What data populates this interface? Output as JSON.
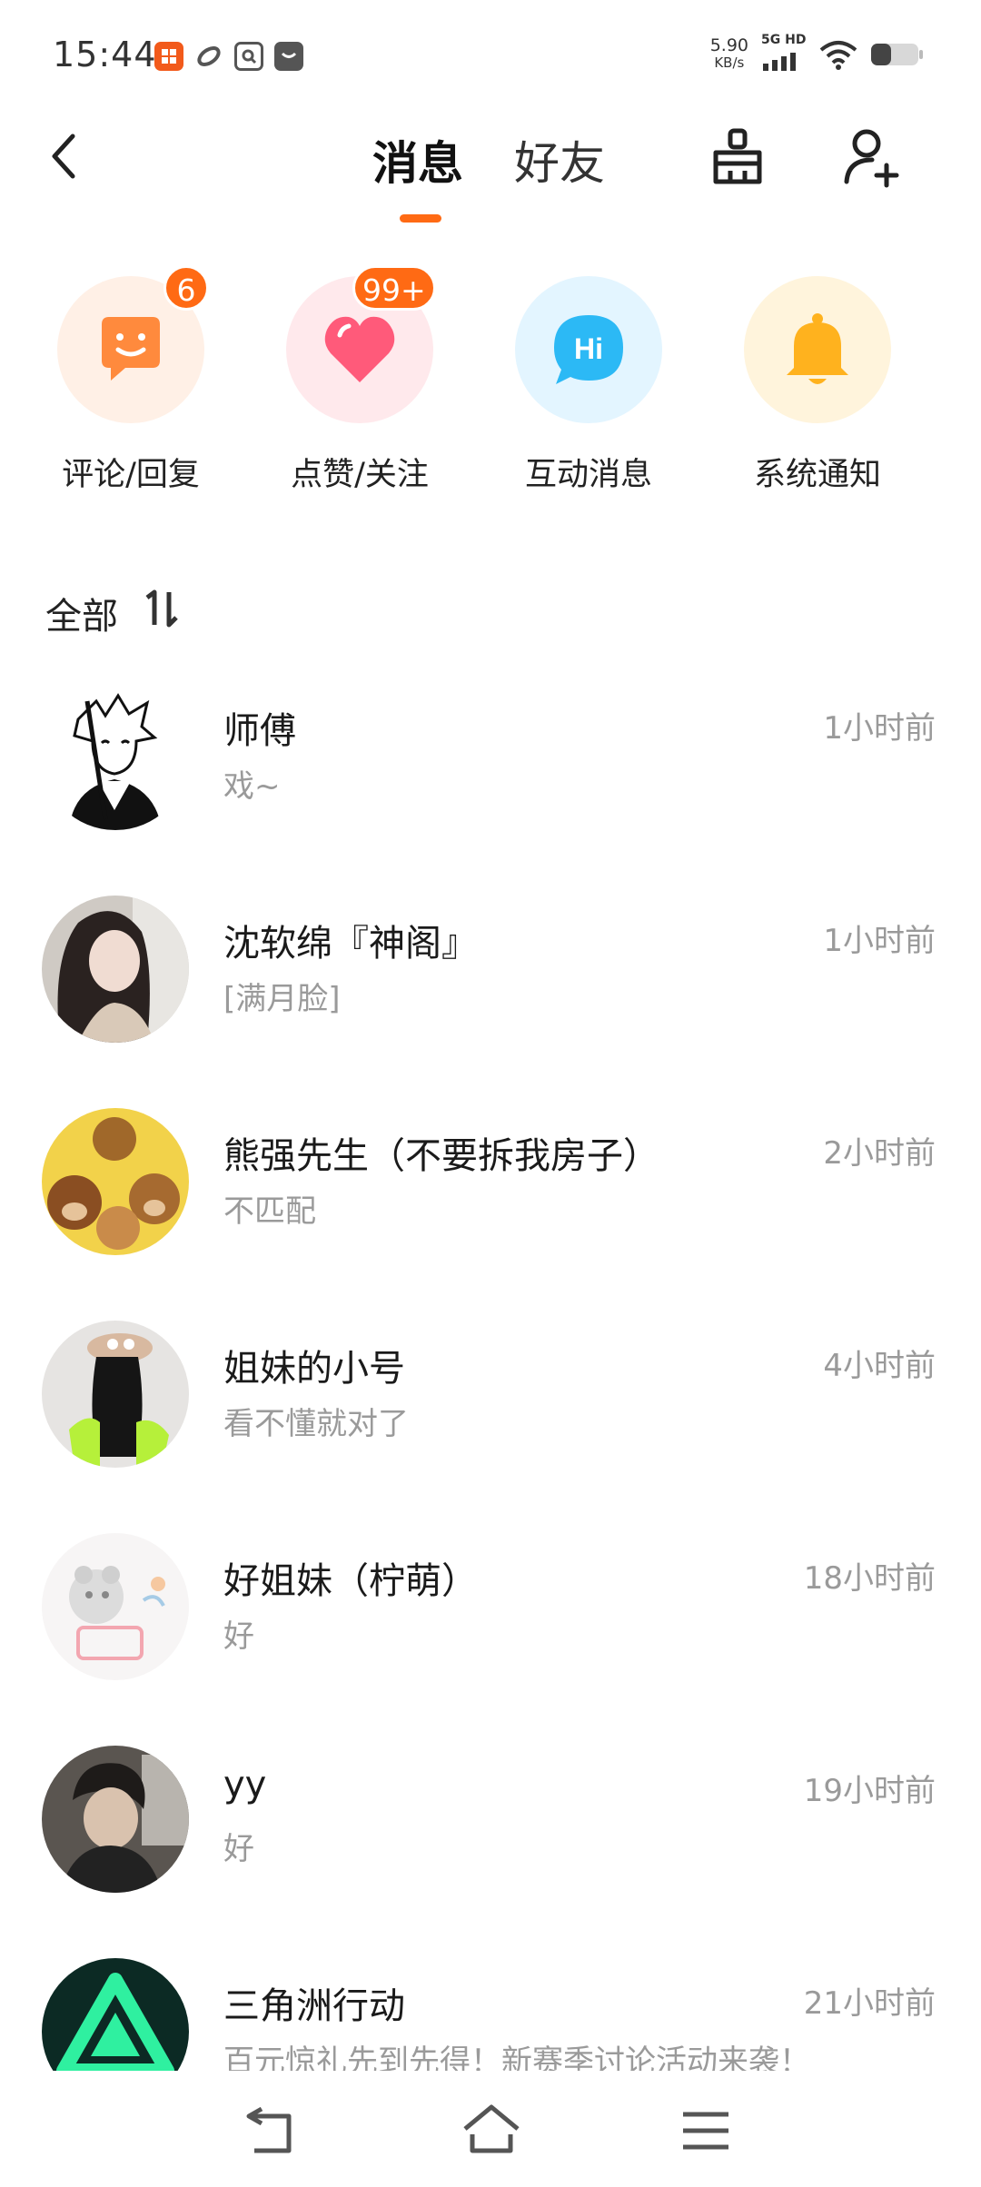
{
  "status_bar": {
    "time": "15:44",
    "net_speed": "5.90",
    "net_unit": "KB/s",
    "signal_label": "5G HD",
    "notification_icons": [
      "xiaohongshu-icon",
      "app-link-icon",
      "app-search-icon",
      "app-inbox-icon"
    ],
    "notification_colors": [
      "#f25a1b",
      "#555555",
      "#555555",
      "#555555"
    ]
  },
  "header": {
    "tab_messages": "消息",
    "tab_friends": "好友",
    "accent_color": "#ff6a14"
  },
  "categories": [
    {
      "label": "评论/回复",
      "icon": "smile-chat-icon",
      "badge": "6",
      "bg": "#fff0e6",
      "color": "#ff8a3d"
    },
    {
      "label": "点赞/关注",
      "icon": "heart-icon",
      "badge": "99+",
      "bg": "#ffe9ec",
      "color": "#ff5a7a"
    },
    {
      "label": "互动消息",
      "icon": "hi-chat-icon",
      "badge": "",
      "bg": "#e3f5ff",
      "color": "#2cb9f5"
    },
    {
      "label": "系统通知",
      "icon": "bell-icon",
      "badge": "",
      "bg": "#fff4dc",
      "color": "#ffb21e"
    }
  ],
  "section": {
    "title": "全部"
  },
  "conversations": [
    {
      "name": "师傅",
      "preview": "戏~",
      "time": "1小时前"
    },
    {
      "name": "沈软绵『神阁』",
      "preview": "[满月脸]",
      "time": "1小时前"
    },
    {
      "name": "熊强先生（不要拆我房子）",
      "preview": "不匹配",
      "time": "2小时前"
    },
    {
      "name": "姐妹的小号",
      "preview": "看不懂就对了",
      "time": "4小时前"
    },
    {
      "name": "好姐妹（柠萌）",
      "preview": "好",
      "time": "18小时前"
    },
    {
      "name": "yy",
      "preview": "好",
      "time": "19小时前"
    },
    {
      "name": "三角洲行动",
      "preview": "百元惊礼先到先得！新赛季讨论活动来袭！",
      "time": "21小时前"
    }
  ],
  "nav": {
    "icons": [
      "back-nav-icon",
      "home-nav-icon",
      "menu-nav-icon"
    ]
  }
}
